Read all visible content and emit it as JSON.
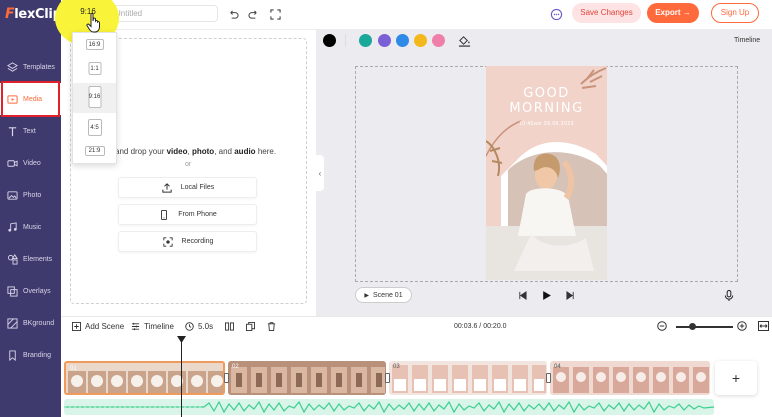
{
  "app": {
    "logo": "FlexClip",
    "logo_first": "F",
    "logo_rest": "lexClip"
  },
  "sidebar": {
    "items": [
      {
        "label": "Templates",
        "icon": "templates-icon"
      },
      {
        "label": "Media",
        "icon": "media-icon",
        "active": true
      },
      {
        "label": "Text",
        "icon": "text-icon"
      },
      {
        "label": "Video",
        "icon": "video-icon"
      },
      {
        "label": "Photo",
        "icon": "photo-icon"
      },
      {
        "label": "Music",
        "icon": "music-icon"
      },
      {
        "label": "Elements",
        "icon": "elements-icon"
      },
      {
        "label": "Overlays",
        "icon": "overlays-icon"
      },
      {
        "label": "BKground",
        "icon": "background-icon"
      },
      {
        "label": "Branding",
        "icon": "branding-icon"
      }
    ]
  },
  "topbar": {
    "ratio": "9:16",
    "title_placeholder": "Untitled",
    "save_label": "Save Changes",
    "export_label": "Export →",
    "signup_label": "Sign Up"
  },
  "ratio_menu": {
    "options": [
      "16:9",
      "1:1",
      "9:16",
      "4:5",
      "21:9"
    ],
    "selected": "9:16"
  },
  "media_panel": {
    "drop_prefix": "and drop your",
    "video": "video",
    "comma1": ",",
    "photo": "photo",
    "comma_and": ", and",
    "audio": "audio",
    "suffix": "here.",
    "or": "or",
    "local_files": "Local Files",
    "from_phone": "From Phone",
    "recording": "Recording"
  },
  "stage": {
    "timeline_label": "Timeline",
    "swatch_colors": [
      "#000000",
      "#1aa89a",
      "#7b5fd6",
      "#2e8ae6",
      "#f2b81c",
      "#ef7fa6"
    ],
    "greeting_line1": "GOOD",
    "greeting_line2": "MORNING",
    "greeting_time": "10:45am   26.06.2023",
    "scene_label": "Scene 01"
  },
  "bottom_toolbar": {
    "add_scene": "Add Scene",
    "timeline": "Timeline",
    "duration": "5.0s",
    "time": "00:03.6 / 00:20.0"
  },
  "timeline": {
    "clips": [
      {
        "num": "01"
      },
      {
        "num": "02"
      },
      {
        "num": "03"
      },
      {
        "num": "04"
      }
    ],
    "add_symbol": "+"
  },
  "colors": {
    "accent": "#ff6a3d",
    "sidebar_bg": "#3e3a6d",
    "highlight": "#f9f33a",
    "audio": "#3ccf8e"
  }
}
